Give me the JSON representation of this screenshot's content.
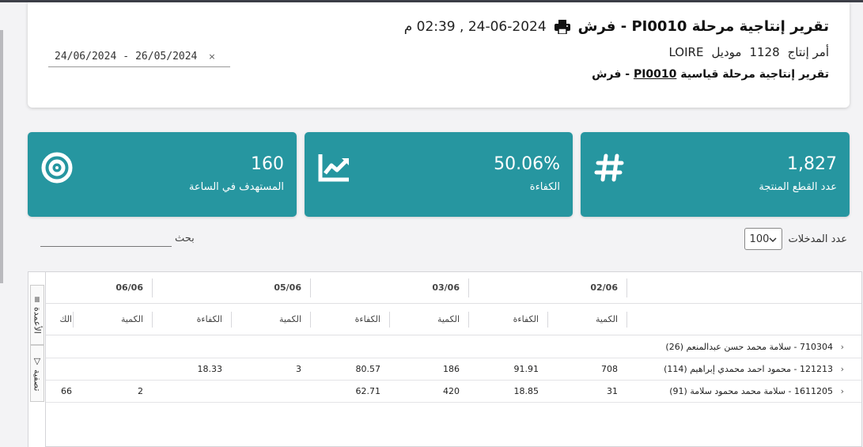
{
  "header": {
    "title": "تقرير إنتاجية مرحلة PI0010 - فرش",
    "datetime": "24-06-2024 , 02:39 م",
    "order_label": "أمر إنتاج",
    "order_number": "1128",
    "model_label": "موديل",
    "model_name": "LOIRE",
    "subtitle_prefix": "تقرير إنتاجية مرحلة قياسية",
    "subtitle_link": "PI0010",
    "subtitle_suffix": " - فرش",
    "print_icon": "print-icon"
  },
  "date_range": {
    "end": "24/06/2024",
    "separator": "-",
    "start": "26/05/2024",
    "clear": "×"
  },
  "stats": [
    {
      "value": "1,827",
      "label": "عدد القطع المنتجة",
      "icon": "hash-icon"
    },
    {
      "value": "50.06%",
      "label": "الكفاءة",
      "icon": "chart-line-icon"
    },
    {
      "value": "160",
      "label": "المستهدف في الساعة",
      "icon": "target-icon"
    }
  ],
  "accent_color": "#2696a0",
  "controls": {
    "entries_label": "عدد المدخلات",
    "entries_value": "100",
    "search_label": "بحث"
  },
  "side_tabs": {
    "columns": "الأعمدة",
    "filter": "تصفية"
  },
  "grid": {
    "dates": [
      "02/06",
      "03/06",
      "05/06",
      "06/06"
    ],
    "qty_header": "الكمية",
    "eff_header": "الكفاءة",
    "cut_header": "الك",
    "rows": [
      {
        "name": "710304 - سلامة محمد حسن عبدالمنعم (26)",
        "values": [
          "",
          "",
          "",
          "",
          "",
          "",
          "",
          ""
        ],
        "cut": ""
      },
      {
        "name": "121213 - محمود احمد محمدي إبراهيم (114)",
        "values": [
          "708",
          "91.91",
          "186",
          "80.57",
          "3",
          "18.33",
          "",
          ""
        ],
        "cut": ""
      },
      {
        "name": "1611205 - سلامة محمد محمود سلامة (91)",
        "values": [
          "31",
          "18.85",
          "420",
          "62.71",
          "",
          "",
          "2",
          ""
        ],
        "cut": "66"
      }
    ]
  }
}
